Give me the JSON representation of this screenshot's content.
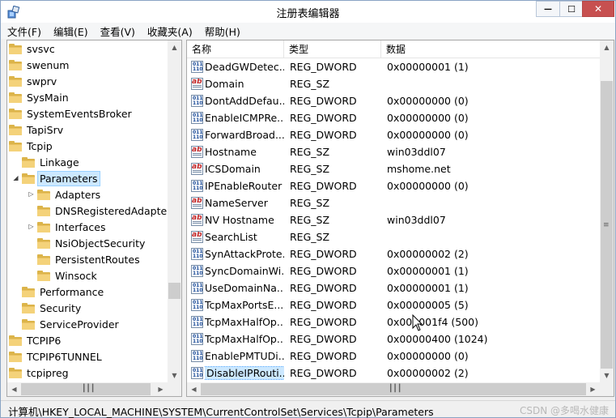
{
  "window": {
    "title": "注册表编辑器",
    "controls": {
      "minimize": "—",
      "maximize": "☐",
      "close": "✕"
    }
  },
  "menu": [
    "文件(F)",
    "编辑(E)",
    "查看(V)",
    "收藏夹(A)",
    "帮助(H)"
  ],
  "tree": {
    "items": [
      {
        "label": "svsvc",
        "level": 0,
        "expander": ""
      },
      {
        "label": "swenum",
        "level": 0,
        "expander": ""
      },
      {
        "label": "swprv",
        "level": 0,
        "expander": ""
      },
      {
        "label": "SysMain",
        "level": 0,
        "expander": ""
      },
      {
        "label": "SystemEventsBroker",
        "level": 0,
        "expander": ""
      },
      {
        "label": "TapiSrv",
        "level": 0,
        "expander": ""
      },
      {
        "label": "Tcpip",
        "level": 0,
        "expander": ""
      },
      {
        "label": "Linkage",
        "level": 1,
        "expander": ""
      },
      {
        "label": "Parameters",
        "level": 1,
        "expander": "◢",
        "selected": true
      },
      {
        "label": "Adapters",
        "level": 2,
        "expander": "▷"
      },
      {
        "label": "DNSRegisteredAdapters",
        "level": 2,
        "expander": ""
      },
      {
        "label": "Interfaces",
        "level": 2,
        "expander": "▷"
      },
      {
        "label": "NsiObjectSecurity",
        "level": 2,
        "expander": ""
      },
      {
        "label": "PersistentRoutes",
        "level": 2,
        "expander": ""
      },
      {
        "label": "Winsock",
        "level": 2,
        "expander": ""
      },
      {
        "label": "Performance",
        "level": 1,
        "expander": ""
      },
      {
        "label": "Security",
        "level": 1,
        "expander": ""
      },
      {
        "label": "ServiceProvider",
        "level": 1,
        "expander": ""
      },
      {
        "label": "TCPIP6",
        "level": 0,
        "expander": ""
      },
      {
        "label": "TCPIP6TUNNEL",
        "level": 0,
        "expander": ""
      },
      {
        "label": "tcpipreg",
        "level": 0,
        "expander": ""
      }
    ]
  },
  "list": {
    "columns": [
      "名称",
      "类型",
      "数据"
    ],
    "rows": [
      {
        "icon": "dword",
        "name": "DeadGWDetec...",
        "type": "REG_DWORD",
        "data": "0x00000001 (1)"
      },
      {
        "icon": "sz",
        "name": "Domain",
        "type": "REG_SZ",
        "data": ""
      },
      {
        "icon": "dword",
        "name": "DontAddDefau...",
        "type": "REG_DWORD",
        "data": "0x00000000 (0)"
      },
      {
        "icon": "dword",
        "name": "EnableICMPRe...",
        "type": "REG_DWORD",
        "data": "0x00000000 (0)"
      },
      {
        "icon": "dword",
        "name": "ForwardBroad...",
        "type": "REG_DWORD",
        "data": "0x00000000 (0)"
      },
      {
        "icon": "sz",
        "name": "Hostname",
        "type": "REG_SZ",
        "data": "win03ddl07"
      },
      {
        "icon": "sz",
        "name": "ICSDomain",
        "type": "REG_SZ",
        "data": "mshome.net"
      },
      {
        "icon": "dword",
        "name": "IPEnableRouter",
        "type": "REG_DWORD",
        "data": "0x00000000 (0)"
      },
      {
        "icon": "sz",
        "name": "NameServer",
        "type": "REG_SZ",
        "data": ""
      },
      {
        "icon": "sz",
        "name": "NV Hostname",
        "type": "REG_SZ",
        "data": "win03ddl07"
      },
      {
        "icon": "sz",
        "name": "SearchList",
        "type": "REG_SZ",
        "data": ""
      },
      {
        "icon": "dword",
        "name": "SynAttackProte...",
        "type": "REG_DWORD",
        "data": "0x00000002 (2)"
      },
      {
        "icon": "dword",
        "name": "SyncDomainWi...",
        "type": "REG_DWORD",
        "data": "0x00000001 (1)"
      },
      {
        "icon": "dword",
        "name": "UseDomainNa...",
        "type": "REG_DWORD",
        "data": "0x00000001 (1)"
      },
      {
        "icon": "dword",
        "name": "TcpMaxPortsE...",
        "type": "REG_DWORD",
        "data": "0x00000005 (5)"
      },
      {
        "icon": "dword",
        "name": "TcpMaxHalfOp...",
        "type": "REG_DWORD",
        "data": "0x000001f4 (500)"
      },
      {
        "icon": "dword",
        "name": "TcpMaxHalfOp...",
        "type": "REG_DWORD",
        "data": "0x00000400 (1024)"
      },
      {
        "icon": "dword",
        "name": "EnablePMTUDi...",
        "type": "REG_DWORD",
        "data": "0x00000000 (0)"
      },
      {
        "icon": "dword",
        "name": "DisableIPRouti...",
        "type": "REG_DWORD",
        "data": "0x00000002 (2)",
        "selected": true
      }
    ]
  },
  "icons": {
    "sz_glyph": "ab",
    "dword_glyph_top": "011",
    "dword_glyph_bottom": "110"
  },
  "status": {
    "path": "计算机\\HKEY_LOCAL_MACHINE\\SYSTEM\\CurrentControlSet\\Services\\Tcpip\\Parameters",
    "watermark": "CSDN @多喝水健康"
  },
  "colors": {
    "selection": "#cce8ff",
    "folder": "#f4d27a",
    "close_button": "#c75050"
  }
}
